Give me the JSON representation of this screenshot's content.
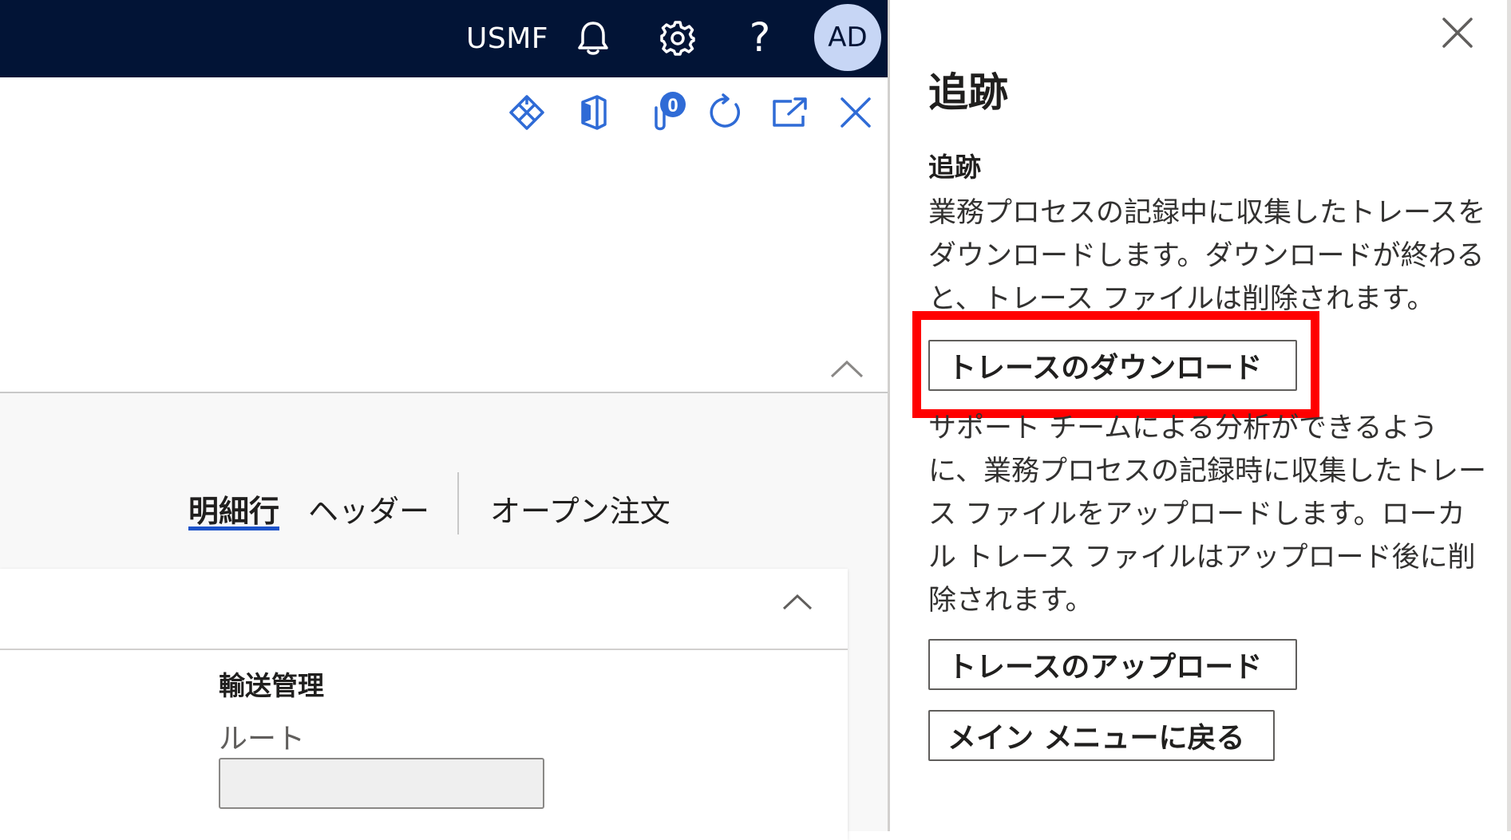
{
  "topbar": {
    "company": "USMF",
    "help_glyph": "?",
    "avatar_initials": "AD",
    "background_color": "#021436"
  },
  "actionbar": {
    "icons": [
      "power-apps-icon",
      "office-icon",
      "attachments-icon",
      "refresh-icon",
      "open-new-window-icon",
      "close-icon"
    ],
    "attachment_count": "0",
    "icon_color": "#2f6bd6"
  },
  "tabs": {
    "lines": "明細行",
    "header": "ヘッダー",
    "open_orders": "オープン注文",
    "active_tab": "明細行",
    "accent_color": "#1c53c9"
  },
  "card": {
    "section_title": "輸送管理",
    "route_label": "ルート",
    "route_value": ""
  },
  "pane": {
    "title": "追跡",
    "subtitle": "追跡",
    "download_description": "業務プロセスの記録中に収集したトレースをダウンロードします。ダウンロードが終わると、トレース ファイルは削除されます。",
    "download_button": "トレースのダウンロード",
    "upload_description": "サポート チームによる分析ができるように、業務プロセスの記録時に収集したトレース ファイルをアップロードします。ローカル トレース ファイルはアップロード後に削除されます。",
    "upload_button": "トレースのアップロード",
    "back_button": "メイン メニューに戻る",
    "highlight_color": "#ff0000"
  }
}
